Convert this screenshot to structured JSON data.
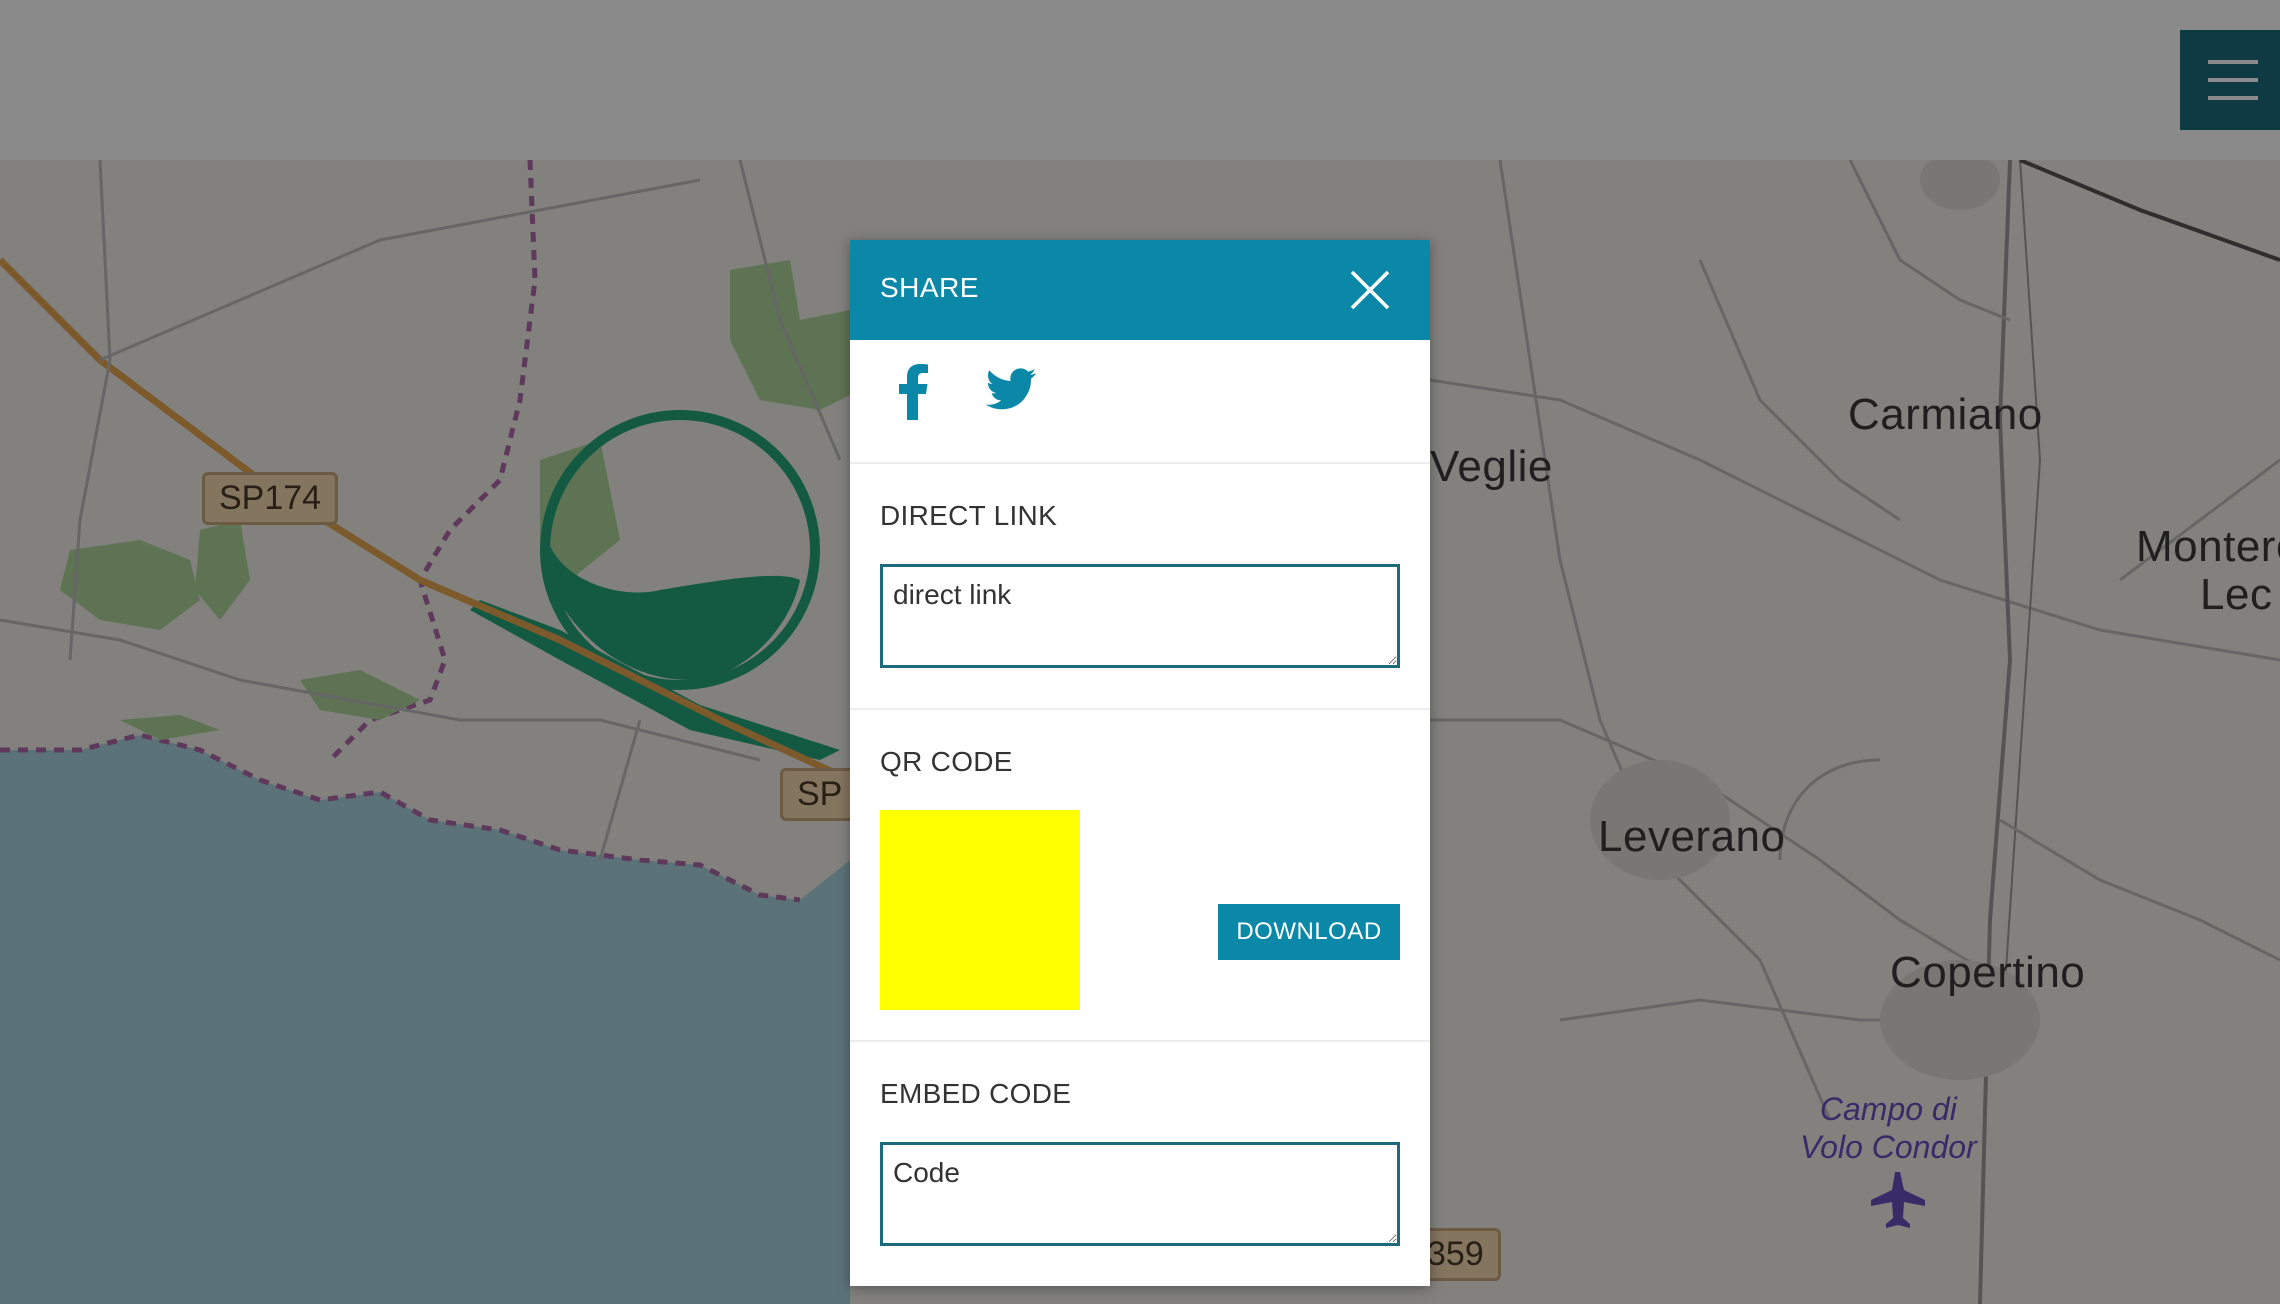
{
  "map": {
    "towns": [
      "Carmiano",
      "Veglie",
      "Leverano",
      "Copertino",
      "Montero",
      "Lec"
    ],
    "road_shields": [
      "SP174",
      "SP",
      "359"
    ],
    "airport": {
      "line1": "Campo di",
      "line2": "Volo Condor"
    }
  },
  "colors": {
    "header_bg": "#ffffff",
    "menu_button": "#1b6b7c",
    "modal_header": "#0b88a8",
    "accent": "#0b88a8",
    "field_border": "#1b6b7c",
    "qr_placeholder": "#ffff00"
  },
  "header": {
    "menu_icon": "hamburger-icon"
  },
  "modal": {
    "title": "SHARE",
    "close_icon": "close-icon",
    "social": {
      "facebook_icon": "facebook-icon",
      "twitter_icon": "twitter-icon"
    },
    "direct_link": {
      "label": "DIRECT LINK",
      "placeholder": "direct link"
    },
    "qr_code": {
      "label": "QR CODE",
      "download_label": "DOWNLOAD"
    },
    "embed_code": {
      "label": "EMBED CODE",
      "placeholder": "Code"
    }
  }
}
